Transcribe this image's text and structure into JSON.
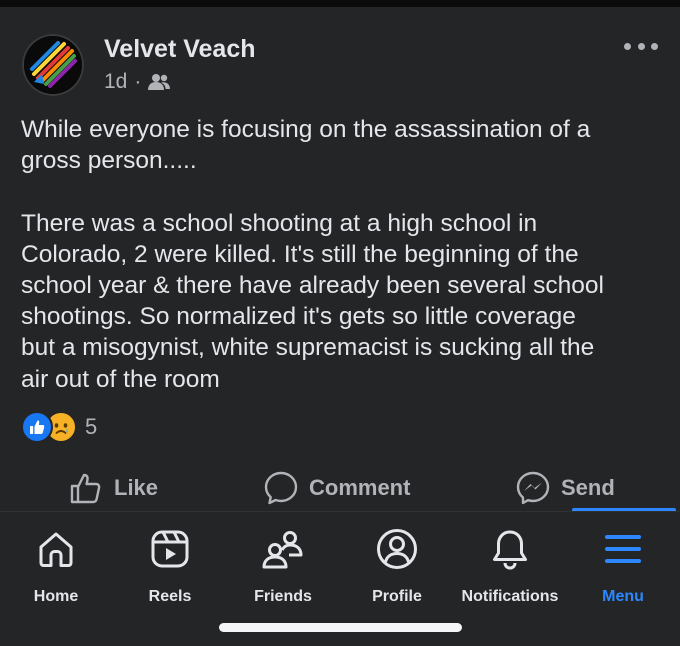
{
  "post": {
    "author": "Velvet Veach",
    "time": "1d",
    "separator": "·",
    "audience_icon": "friends-audience-icon",
    "more_icon": "more-options-icon",
    "text": "While everyone is focusing on the assassination of a\ngross person.....\n\nThere was a school shooting at a high school in\nColorado, 2 were killed. It's still the beginning of the\nschool year & there have already been several school\nshootings. So normalized it's gets so little coverage\nbut a misogynist, white supremacist is sucking all the\nair out of the room",
    "reactions": {
      "icons": [
        "like-reaction-icon",
        "sad-reaction-icon"
      ],
      "count": "5"
    }
  },
  "actions": {
    "like": "Like",
    "comment": "Comment",
    "send": "Send"
  },
  "nav": {
    "tabs": [
      {
        "label": "Home",
        "icon": "home-icon"
      },
      {
        "label": "Reels",
        "icon": "reels-icon"
      },
      {
        "label": "Friends",
        "icon": "friends-icon"
      },
      {
        "label": "Profile",
        "icon": "profile-icon"
      },
      {
        "label": "Notifications",
        "icon": "bell-icon"
      },
      {
        "label": "Menu",
        "icon": "menu-icon"
      }
    ],
    "active": "Menu"
  },
  "colors": {
    "background": "#242526",
    "text": "#e4e6eb",
    "secondary": "#b0b3b8",
    "accent": "#2d88ff"
  }
}
